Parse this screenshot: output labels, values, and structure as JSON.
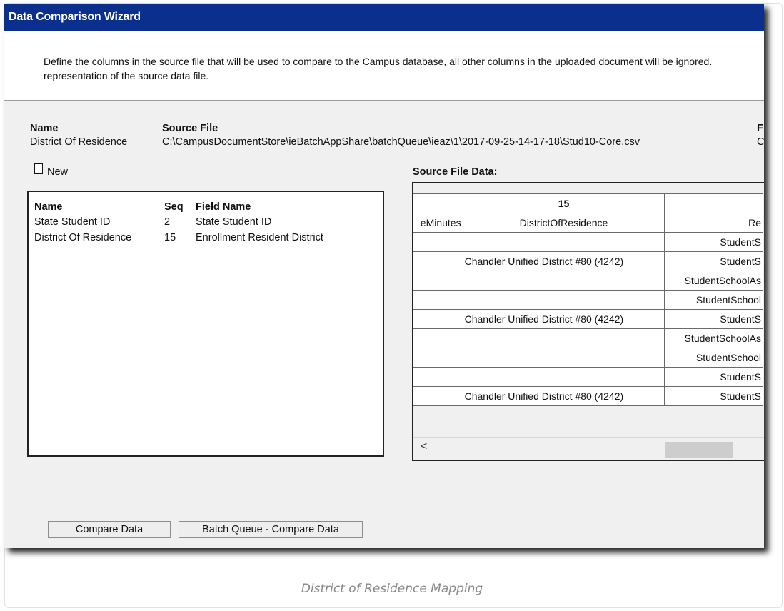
{
  "window": {
    "title": "Data Comparison Wizard"
  },
  "instructions": "Define the columns in the source file that will be used to compare to the Campus database, all other columns in the uploaded document will be ignored.\nrepresentation of the source data file.",
  "info": {
    "name_header": "Name",
    "name_value": "District Of Residence",
    "source_header": "Source File",
    "source_value": "C:\\CampusDocumentStore\\ieBatchAppShare\\batchQueue\\ieaz\\1\\2017-09-25-14-17-18\\Stud10-Core.csv",
    "extra_header": "F",
    "extra_value": "C"
  },
  "new_label": "New",
  "mapping": {
    "headers": {
      "name": "Name",
      "seq": "Seq",
      "field": "Field Name"
    },
    "rows": [
      {
        "name": "State Student ID",
        "seq": "2",
        "field": "State Student ID"
      },
      {
        "name": "District Of Residence",
        "seq": "15",
        "field": "Enrollment Resident District"
      }
    ]
  },
  "source_data": {
    "title": "Source File Data:",
    "column_number": "15",
    "header_row": [
      "eMinutes",
      "DistrictOfResidence",
      "Re"
    ],
    "rows": [
      [
        "",
        "",
        "StudentS"
      ],
      [
        "",
        "Chandler Unified District #80 (4242)",
        "StudentS"
      ],
      [
        "",
        "",
        "StudentSchoolAs"
      ],
      [
        "",
        "",
        "StudentSchool"
      ],
      [
        "",
        "Chandler Unified District #80 (4242)",
        "StudentS"
      ],
      [
        "",
        "",
        "StudentSchoolAs"
      ],
      [
        "",
        "",
        "StudentSchool"
      ],
      [
        "",
        "",
        "StudentS"
      ],
      [
        "",
        "Chandler Unified District #80 (4242)",
        "StudentS"
      ]
    ],
    "scroll_left_glyph": "<"
  },
  "buttons": {
    "compare": "Compare Data",
    "batch": "Batch Queue - Compare Data"
  },
  "caption": "District of Residence Mapping"
}
